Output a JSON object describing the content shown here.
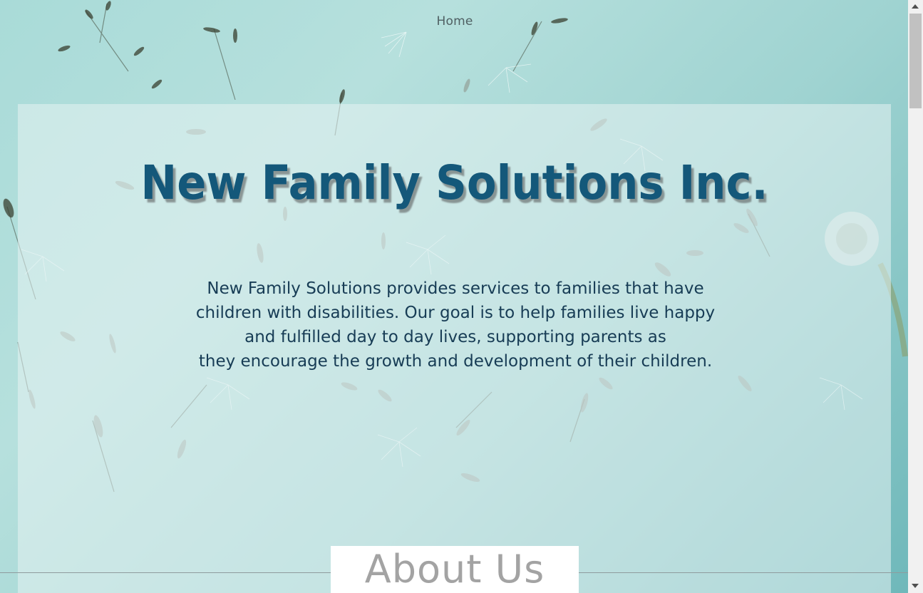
{
  "nav": {
    "home_label": "Home"
  },
  "hero": {
    "title": "New Family Solutions Inc.",
    "description_lines": [
      "New Family Solutions provides services to families that have",
      "children with disabilities. Our goal is to help families live happy",
      "and fulfilled day to day lives, supporting parents as",
      "they encourage the growth and development of their children."
    ]
  },
  "section": {
    "about_heading": "About Us"
  },
  "colors": {
    "title": "#14587a",
    "description": "#173c55",
    "nav": "#4f5f62",
    "about_heading": "#a3a3a3",
    "background": "#a9dbd8"
  },
  "icons": {
    "scroll_up": "triangle-up",
    "scroll_down": "triangle-down"
  }
}
